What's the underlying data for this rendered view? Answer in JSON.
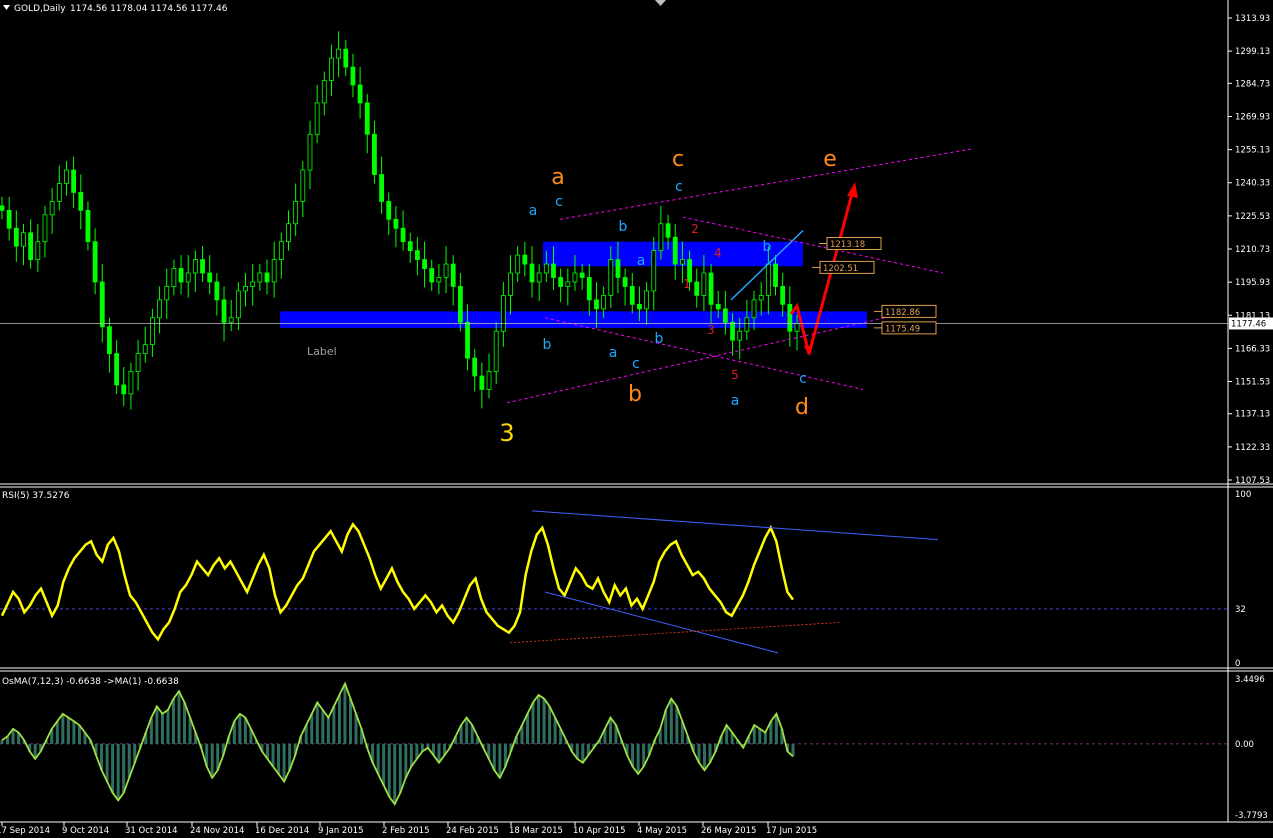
{
  "header": {
    "symbol_label": "GOLD,Daily",
    "ohlc": "1174.56 1178.04 1174.56 1177.46"
  },
  "chart_data": [
    {
      "type": "candlestick",
      "title": "GOLD,Daily",
      "ohlc_last": {
        "open": 1174.56,
        "high": 1178.04,
        "low": 1174.56,
        "close": 1177.46
      },
      "ylim": [
        1107.53,
        1313.93
      ],
      "y_ticks": [
        "1313.93",
        "1299.13",
        "1284.73",
        "1269.93",
        "1255.13",
        "1240.33",
        "1225.53",
        "1210.73",
        "1195.93",
        "1181.13",
        "1166.33",
        "1151.53",
        "1137.13",
        "1122.33",
        "1107.53"
      ],
      "x_ticks": [
        "17 Sep 2014",
        "9 Oct 2014",
        "31 Oct 2014",
        "24 Nov 2014",
        "16 Dec 2014",
        "9 Jan 2015",
        "2 Feb 2015",
        "24 Feb 2015",
        "18 Mar 2015",
        "10 Apr 2015",
        "4 May 2015",
        "26 May 2015",
        "17 Jun 2015"
      ],
      "current_price": "1177.46",
      "price_levels": [
        "1213.18",
        "1202.51",
        "1182.86",
        "1175.49"
      ],
      "text_label": "Label",
      "closes": [
        1228,
        1220,
        1212,
        1218,
        1206,
        1214,
        1226,
        1232,
        1240,
        1246,
        1236,
        1228,
        1214,
        1196,
        1176,
        1164,
        1150,
        1146,
        1156,
        1164,
        1168,
        1180,
        1188,
        1194,
        1202,
        1196,
        1200,
        1206,
        1200,
        1196,
        1188,
        1178,
        1180,
        1192,
        1194,
        1196,
        1200,
        1196,
        1206,
        1214,
        1222,
        1232,
        1246,
        1262,
        1276,
        1286,
        1296,
        1300,
        1292,
        1284,
        1276,
        1262,
        1244,
        1232,
        1224,
        1220,
        1214,
        1210,
        1206,
        1202,
        1196,
        1198,
        1204,
        1194,
        1178,
        1162,
        1154,
        1148,
        1156,
        1174,
        1190,
        1200,
        1208,
        1204,
        1196,
        1200,
        1204,
        1198,
        1194,
        1196,
        1200,
        1198,
        1188,
        1184,
        1190,
        1206,
        1198,
        1194,
        1186,
        1184,
        1192,
        1210,
        1222,
        1216,
        1204,
        1206,
        1196,
        1190,
        1200,
        1186,
        1184,
        1178,
        1170,
        1174,
        1180,
        1188,
        1190,
        1204,
        1194,
        1186,
        1174,
        1177.46
      ],
      "wave_labels": [
        {
          "text": "a",
          "color": "#ff8c1a"
        },
        {
          "text": "c",
          "color": "#ff8c1a"
        },
        {
          "text": "e",
          "color": "#ff8c1a"
        },
        {
          "text": "b",
          "color": "#ff8c1a"
        },
        {
          "text": "d",
          "color": "#ff8c1a"
        },
        {
          "text": "3",
          "color": "#ffd700"
        },
        {
          "text": "a",
          "color": "#1ea7ff"
        },
        {
          "text": "c",
          "color": "#1ea7ff"
        },
        {
          "text": "c",
          "color": "#1ea7ff"
        },
        {
          "text": "b",
          "color": "#1ea7ff"
        },
        {
          "text": "a",
          "color": "#1ea7ff"
        },
        {
          "text": "b",
          "color": "#1ea7ff"
        },
        {
          "text": "b",
          "color": "#1ea7ff"
        },
        {
          "text": "a",
          "color": "#1ea7ff"
        },
        {
          "text": "c",
          "color": "#1ea7ff"
        },
        {
          "text": "b",
          "color": "#1ea7ff"
        },
        {
          "text": "a",
          "color": "#1ea7ff"
        },
        {
          "text": "c",
          "color": "#1ea7ff"
        },
        {
          "text": "2",
          "color": "#e02020"
        },
        {
          "text": "4",
          "color": "#e02020"
        },
        {
          "text": "1",
          "color": "#e02020"
        },
        {
          "text": "3",
          "color": "#e02020"
        },
        {
          "text": "5",
          "color": "#e02020"
        }
      ],
      "colors": {
        "candles": "#00ff00",
        "zones": "#0000ff",
        "channel": "#ff00ff",
        "arrows": "#ff0000",
        "price_line": "#c0c0c0"
      }
    },
    {
      "type": "line",
      "title": "RSI(5) 37.5276",
      "y_ticks": [
        "100",
        "32",
        "0"
      ],
      "ylim": [
        0,
        100
      ],
      "level": 32,
      "values": [
        28,
        35,
        42,
        38,
        30,
        34,
        40,
        44,
        36,
        28,
        34,
        48,
        56,
        62,
        66,
        70,
        72,
        64,
        60,
        70,
        74,
        66,
        52,
        40,
        36,
        30,
        24,
        18,
        14,
        20,
        24,
        32,
        42,
        46,
        52,
        60,
        56,
        52,
        58,
        62,
        56,
        60,
        54,
        48,
        42,
        50,
        58,
        64,
        56,
        40,
        30,
        34,
        40,
        46,
        50,
        58,
        66,
        70,
        74,
        78,
        72,
        66,
        76,
        82,
        78,
        70,
        62,
        52,
        44,
        50,
        56,
        48,
        42,
        38,
        32,
        36,
        40,
        36,
        30,
        34,
        28,
        24,
        30,
        38,
        46,
        50,
        38,
        30,
        26,
        22,
        20,
        18,
        22,
        30,
        52,
        66,
        76,
        80,
        70,
        56,
        44,
        40,
        48,
        56,
        52,
        46,
        44,
        50,
        42,
        36,
        46,
        40,
        44,
        34,
        38,
        32,
        40,
        48,
        60,
        66,
        70,
        72,
        64,
        58,
        52,
        54,
        50,
        44,
        40,
        36,
        30,
        28,
        34,
        40,
        48,
        58,
        66,
        74,
        80,
        72,
        56,
        42,
        37.5276
      ],
      "color": "#ffff00"
    },
    {
      "type": "bar",
      "title": "OsMA(7,12,3) -0.6638 ->MA(1) -0.6638",
      "y_ticks": [
        "3.4496",
        "0.00",
        "-3.7793"
      ],
      "ylim": [
        -3.7793,
        3.4496
      ],
      "values": [
        0.2,
        0.4,
        0.8,
        0.6,
        0.2,
        -0.4,
        -0.8,
        -0.4,
        0.2,
        0.8,
        1.2,
        1.6,
        1.4,
        1.2,
        1.0,
        0.6,
        0.2,
        -0.6,
        -1.4,
        -2.0,
        -2.6,
        -3.0,
        -2.6,
        -1.8,
        -1.0,
        -0.2,
        0.6,
        1.4,
        2.0,
        1.6,
        1.8,
        2.4,
        2.8,
        2.2,
        1.4,
        0.6,
        -0.2,
        -1.2,
        -1.8,
        -1.4,
        -0.6,
        0.4,
        1.2,
        1.6,
        1.4,
        0.8,
        0.2,
        -0.4,
        -0.8,
        -1.2,
        -1.6,
        -2.0,
        -1.4,
        -0.6,
        0.4,
        1.0,
        1.6,
        2.2,
        1.8,
        1.4,
        2.0,
        2.6,
        3.2,
        2.4,
        1.6,
        0.8,
        -0.2,
        -1.0,
        -1.6,
        -2.2,
        -2.8,
        -3.2,
        -2.6,
        -1.8,
        -1.2,
        -0.8,
        -0.4,
        -0.2,
        -0.6,
        -1.0,
        -0.6,
        -0.2,
        0.4,
        1.0,
        1.4,
        1.0,
        0.4,
        -0.2,
        -0.8,
        -1.4,
        -1.8,
        -1.2,
        -0.4,
        0.4,
        1.0,
        1.6,
        2.2,
        2.6,
        2.4,
        2.0,
        1.4,
        0.8,
        0.2,
        -0.4,
        -0.8,
        -1.0,
        -0.6,
        -0.2,
        0.2,
        0.8,
        1.4,
        1.0,
        0.2,
        -0.6,
        -1.2,
        -1.6,
        -1.2,
        -0.6,
        0.2,
        0.8,
        1.8,
        2.4,
        2.0,
        1.2,
        0.4,
        -0.4,
        -1.0,
        -1.4,
        -1.0,
        -0.4,
        0.4,
        1.0,
        0.6,
        0.2,
        -0.2,
        0.4,
        1.0,
        0.8,
        0.6,
        1.2,
        1.6,
        0.8,
        -0.4,
        -0.6638
      ],
      "color_bars": "#2f6f5f",
      "color_line": "#a0e040"
    }
  ]
}
